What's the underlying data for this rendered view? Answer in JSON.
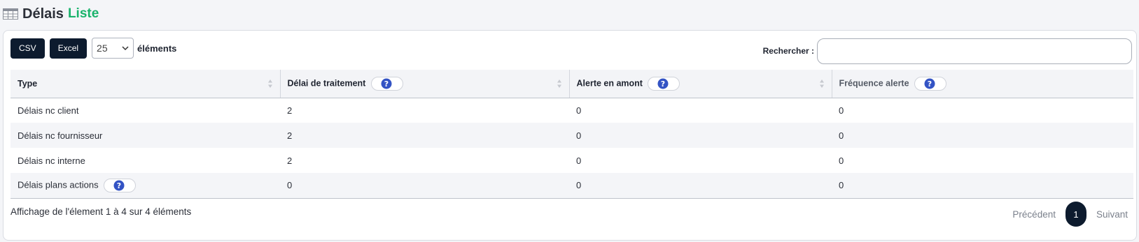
{
  "header": {
    "title": "Délais",
    "subtitle": "Liste"
  },
  "toolbar": {
    "csv_label": "CSV",
    "excel_label": "Excel",
    "page_size": "25",
    "elements_label": "éléments",
    "search_label": "Rechercher :",
    "search_value": ""
  },
  "table": {
    "columns": [
      {
        "label": "Type"
      },
      {
        "label": "Délai de traitement"
      },
      {
        "label": "Alerte en amont"
      },
      {
        "label": "Fréquence alerte"
      }
    ],
    "rows": [
      {
        "type": "Délais nc client",
        "delai": "2",
        "alerte": "0",
        "frequence": "0"
      },
      {
        "type": "Délais nc fournisseur",
        "delai": "2",
        "alerte": "0",
        "frequence": "0"
      },
      {
        "type": "Délais nc interne",
        "delai": "2",
        "alerte": "0",
        "frequence": "0"
      },
      {
        "type": "Délais plans actions",
        "delai": "0",
        "alerte": "0",
        "frequence": "0"
      }
    ]
  },
  "footer": {
    "info": "Affichage de l'élement 1 à 4 sur 4 éléments",
    "prev": "Précédent",
    "current_page": "1",
    "next": "Suivant"
  },
  "colors": {
    "accent": "#19b36b",
    "dark_button": "#0d1b2e",
    "help_icon": "#3353c4"
  },
  "icons": [
    "table-icon",
    "chevron-down-icon",
    "sort-icon",
    "help-icon"
  ]
}
